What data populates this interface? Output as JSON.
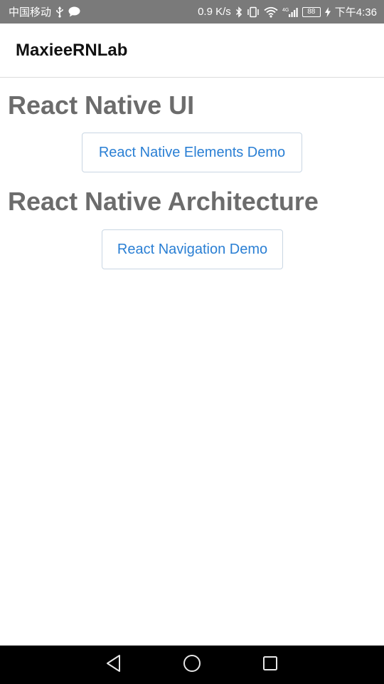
{
  "status_bar": {
    "carrier": "中国移动",
    "usb_icon": "usb-icon",
    "message_icon": "chat-bubble-icon",
    "network_speed": "0.9 K/s",
    "bluetooth_icon": "bluetooth-icon",
    "vibrate_icon": "vibrate-icon",
    "wifi_icon": "wifi-icon",
    "signal_label": "4G",
    "battery_level": "88",
    "time": "下午4:36"
  },
  "header": {
    "title": "MaxieeRNLab"
  },
  "sections": [
    {
      "heading": "React Native UI",
      "button_label": "React Native Elements Demo"
    },
    {
      "heading": "React Native Architecture",
      "button_label": "React Navigation Demo"
    }
  ],
  "nav_bar": {
    "back_icon": "back-triangle-icon",
    "home_icon": "home-circle-icon",
    "recents_icon": "recents-square-icon"
  },
  "colors": {
    "status_bar_bg": "#7a7a7a",
    "heading_gray": "#6c6c6c",
    "button_text_blue": "#2a7fd4",
    "nav_bar_bg": "#000000"
  }
}
